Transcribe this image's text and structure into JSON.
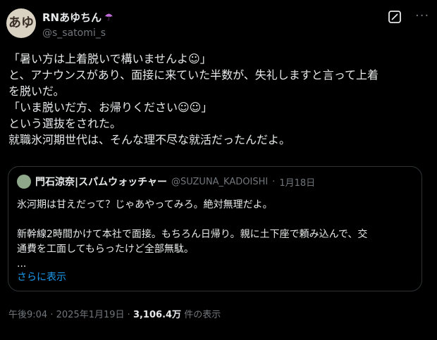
{
  "author": {
    "avatar_text": "あゆ",
    "display_name": "RNあゆちん",
    "name_emoji": "☂",
    "handle": "@s_satomi_s"
  },
  "header_icons": {
    "grok": "grok-icon",
    "more": "more-icon",
    "more_glyph": "···"
  },
  "tweet": {
    "lines": [
      "「暑い方は上着脱いで構いませんよ☺」",
      "と、アナウンスがあり、面接に来ていた半数が、失礼しますと言って上着",
      "を脱いだ。",
      "「いま脱いだ方、お帰りください☺☺」",
      "という選抜をされた。",
      "就職氷河期世代は、そんな理不尽な就活だったんだよ。"
    ]
  },
  "quote": {
    "display_name": "門石涼奈|スパムウォッチャー",
    "handle": "@SUZUNA_KADOISHI",
    "separator": "·",
    "date": "1月18日",
    "lines": [
      "氷河期は甘えだって？じゃあやってみろ。絶対無理だよ。",
      "",
      "新幹線2時間かけて本社で面接。もちろん日帰り。親に土下座で頼み込んで、交",
      "通費を工面してもらったけど全部無駄。",
      "..."
    ],
    "show_more": "さらに表示"
  },
  "meta": {
    "time": "午後9:04",
    "separator": "·",
    "date": "2025年1月19日",
    "separator2": "·",
    "views": "3,106.4万",
    "views_label": "件の表示"
  },
  "colors": {
    "accent": "#1d9bf0",
    "background": "#000000",
    "muted": "#71767b"
  }
}
